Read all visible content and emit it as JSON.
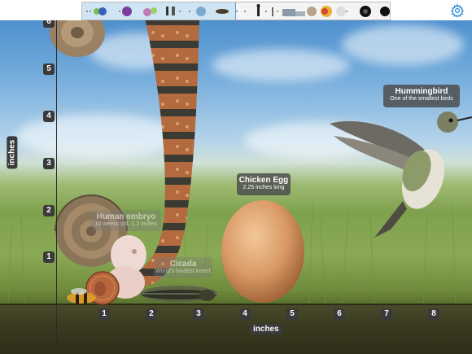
{
  "toolbar": {
    "strip_items": [
      "flower-icon",
      "orb-icon",
      "virus-icon",
      "cells-icon",
      "figure-icon",
      "earth-icon",
      "insect-icon",
      "person-icon",
      "tower-icon",
      "city-icon",
      "planet-icon",
      "sun-icon",
      "galaxy-icon",
      "blackhole-icon"
    ],
    "settings_icon": "gear-icon"
  },
  "axes": {
    "y_ticks": [
      "6",
      "5",
      "4",
      "3",
      "2",
      "1"
    ],
    "x_ticks": [
      "1",
      "2",
      "3",
      "4",
      "5",
      "6",
      "7",
      "8"
    ],
    "y_title": "inches",
    "x_title": "inches"
  },
  "labels": {
    "hummingbird": {
      "title": "Hummingbird",
      "sub": "One of the smallest birds"
    },
    "chicken_egg": {
      "title": "Chicken Egg",
      "sub": "2.25 inches long"
    },
    "human_embryo": {
      "title": "Human embryo",
      "sub": "10 weeks old, 1.2 inches"
    },
    "cicada": {
      "title": "Cicada",
      "sub": "World's loudest insect"
    }
  },
  "colors": {
    "accent": "#2f8fd8",
    "label_bg": "#4a4a4a",
    "tick_bg": "#3a3a3a"
  }
}
